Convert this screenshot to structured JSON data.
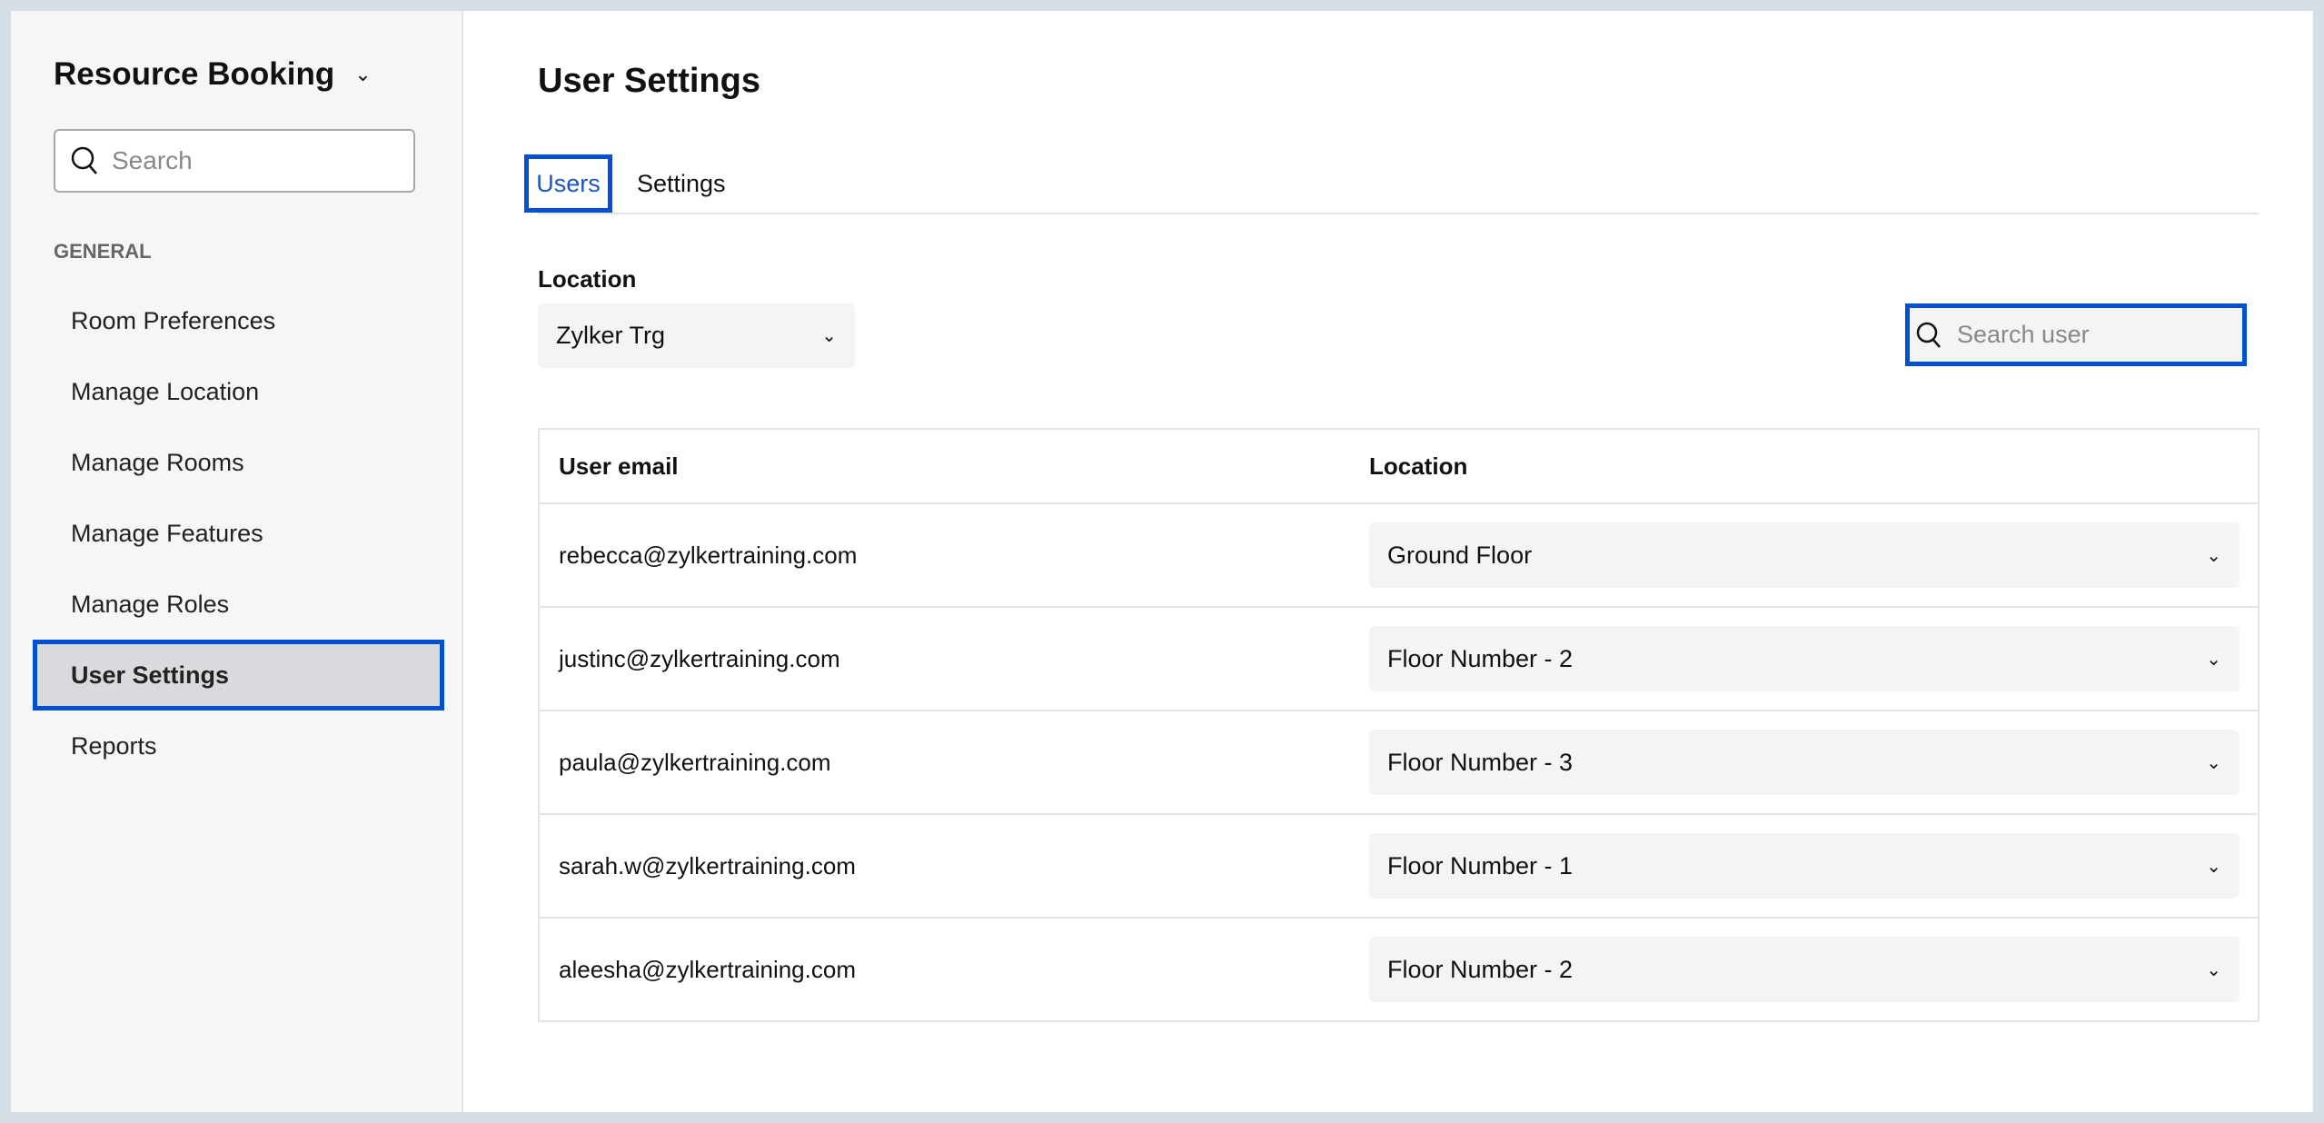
{
  "sidebar": {
    "app_title": "Resource Booking",
    "search_placeholder": "Search",
    "section": "GENERAL",
    "items": [
      {
        "label": "Room Preferences"
      },
      {
        "label": "Manage Location"
      },
      {
        "label": "Manage Rooms"
      },
      {
        "label": "Manage Features"
      },
      {
        "label": "Manage Roles"
      },
      {
        "label": "User Settings",
        "active": true
      },
      {
        "label": "Reports"
      }
    ]
  },
  "main": {
    "title": "User Settings",
    "tabs": [
      {
        "label": "Users",
        "active": true
      },
      {
        "label": "Settings"
      }
    ],
    "location_label": "Location",
    "location_value": "Zylker Trg",
    "search_placeholder": "Search user",
    "table": {
      "headers": [
        "User email",
        "Location"
      ],
      "rows": [
        {
          "email": "rebecca@zylkertraining.com",
          "location": "Ground Floor"
        },
        {
          "email": "justinc@zylkertraining.com",
          "location": "Floor Number - 2"
        },
        {
          "email": "paula@zylkertraining.com",
          "location": "Floor Number - 3"
        },
        {
          "email": "sarah.w@zylkertraining.com",
          "location": "Floor Number - 1"
        },
        {
          "email": "aleesha@zylkertraining.com",
          "location": "Floor Number - 2"
        }
      ]
    }
  },
  "colors": {
    "accent": "#0050d0",
    "sidebar_bg": "#f6f6f6"
  }
}
